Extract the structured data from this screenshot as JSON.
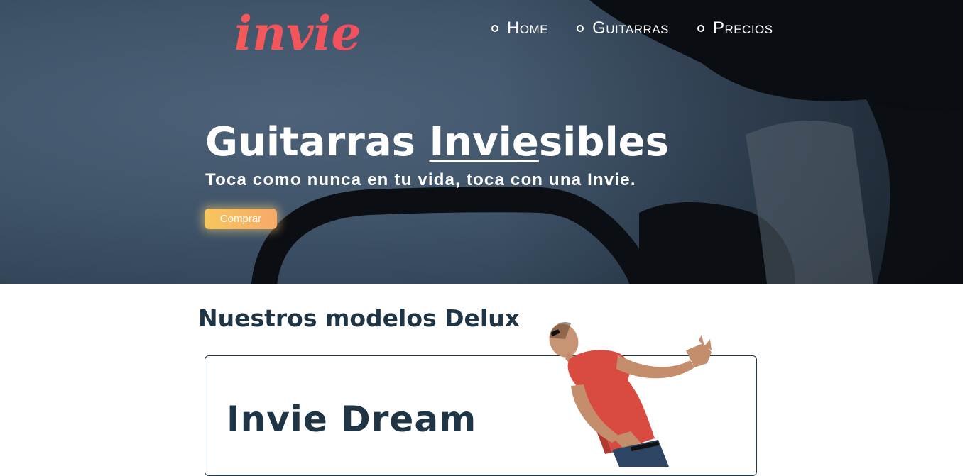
{
  "header": {
    "logo_text": "invie",
    "nav": [
      {
        "label": "Home"
      },
      {
        "label": "Guitarras"
      },
      {
        "label": "Precios"
      }
    ]
  },
  "hero": {
    "title_before": "Guitarras ",
    "title_underlined": "Invie",
    "title_after": "sibles",
    "subtitle": "Toca como nunca en tu vida, toca con una Invie.",
    "button_label": "Comprar"
  },
  "models": {
    "section_title": "Nuestros modelos Delux",
    "card_title": "Invie Dream"
  },
  "colors": {
    "brand_gradient_start": "#f7c75d",
    "brand_gradient_end": "#f6a96a",
    "logo": "#f2585a",
    "heading_dark": "#1f3545",
    "hero_bg": "#3f5369"
  }
}
